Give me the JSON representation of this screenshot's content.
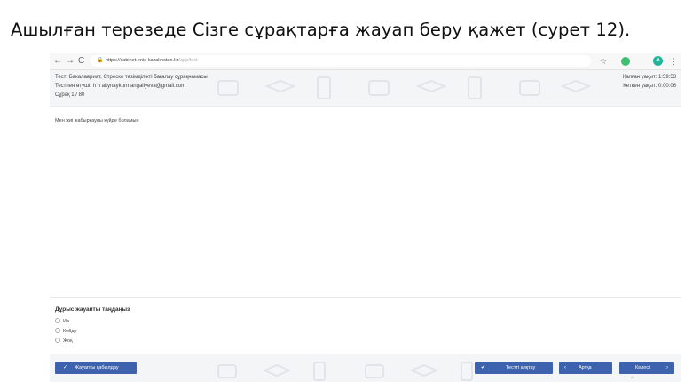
{
  "document": {
    "heading": "Ашылған терезеде Сізге сұрақтарға жауап беру қажет (сурет 12)."
  },
  "browser": {
    "back_icon": "←",
    "forward_icon": "→",
    "reload_icon": "C",
    "lock_icon": "🔒",
    "url_host": "https://cabinet.enic-kazakhstan.kz",
    "url_path": "/app/test",
    "star_icon": "☆",
    "profile_letter": "A",
    "menu_icon": "⋮"
  },
  "test_header": {
    "test_name": "Тест: Бакалавриат, Стреске төзімділікті бағалау сұрақнамасы",
    "tester": "Тестпен өтуші: h h altynaykurmangaliyeva@gmail.com",
    "question_counter": "Сұрақ 1 / 80",
    "time_left": "Қалған уақыт: 1:59:53",
    "time_elapsed": "Кеткен уақыт: 0:00:06"
  },
  "question": {
    "text": "Мен жиі жабырқаулы күйде боламын"
  },
  "answers": {
    "prompt": "Дұрыс жауапты таңдаңыз",
    "options": [
      "Иә",
      "Кейде",
      "Жоқ"
    ]
  },
  "footer": {
    "confirm_icon": "✓",
    "confirm_label": "Жауапты қабылдау",
    "finish_icon": "✔",
    "finish_label": "Тестті аяқтау",
    "back_icon": "‹",
    "back_label": "Артқа",
    "next_label": "Келесі",
    "next_icon": "›",
    "scroll_caret": "^"
  },
  "colors": {
    "button_blue": "#3d63ae",
    "header_bg": "#f4f5f7",
    "pattern_gray": "#e2e4e9"
  }
}
